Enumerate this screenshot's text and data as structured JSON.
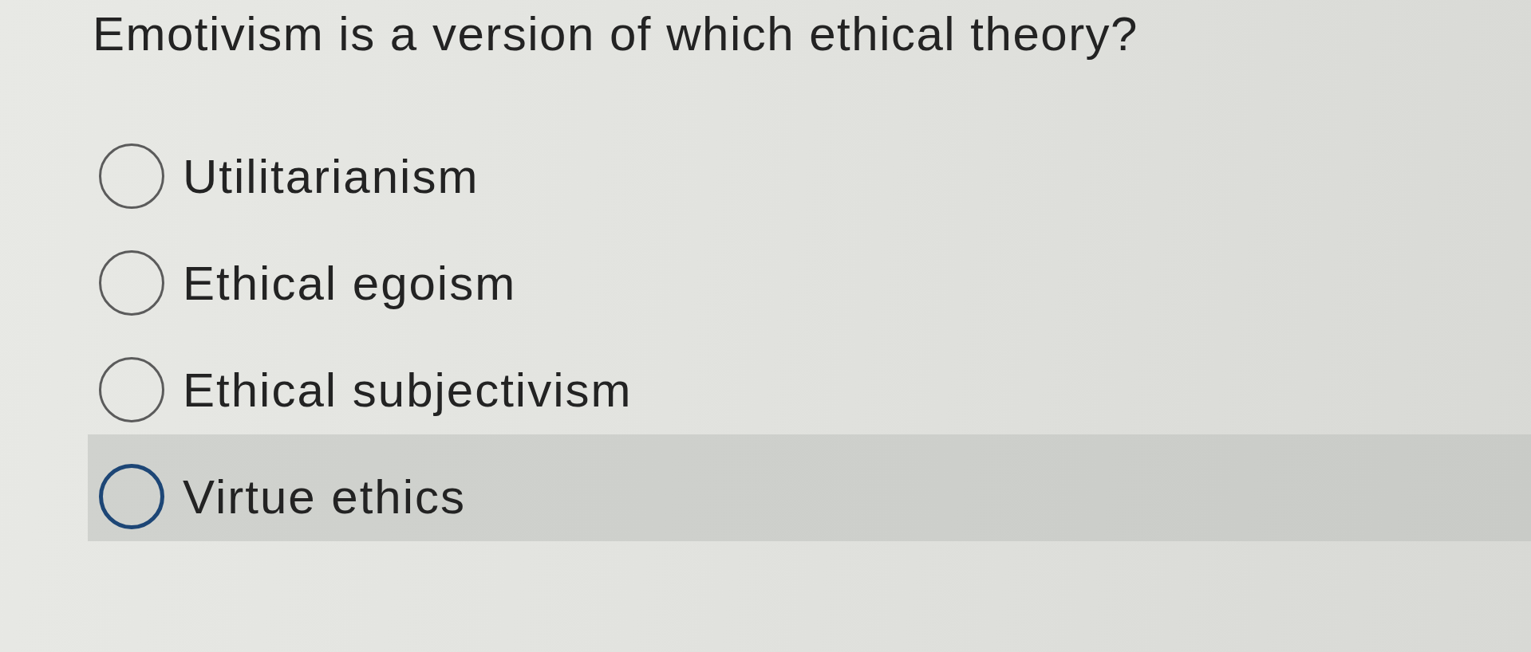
{
  "question": {
    "text": "Emotivism is a version of which ethical theory?"
  },
  "options": [
    {
      "label": "Utilitarianism",
      "selected": false,
      "highlighted": false
    },
    {
      "label": "Ethical egoism",
      "selected": false,
      "highlighted": false
    },
    {
      "label": "Ethical subjectivism",
      "selected": false,
      "highlighted": false
    },
    {
      "label": "Virtue ethics",
      "selected": false,
      "highlighted": true
    }
  ]
}
